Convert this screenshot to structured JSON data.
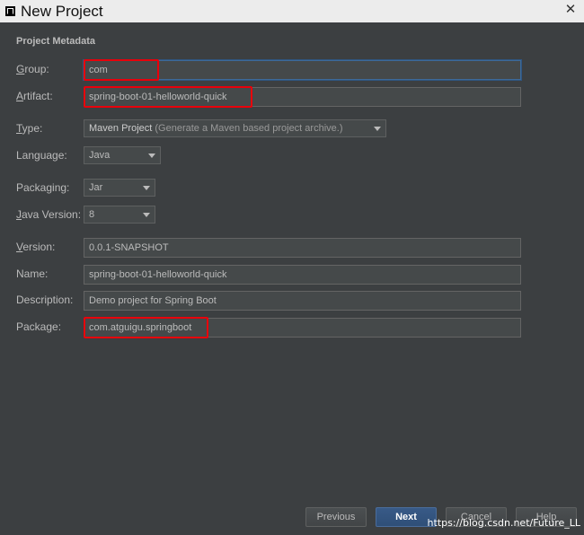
{
  "window": {
    "title": "New Project",
    "close_glyph": "✕"
  },
  "section_title": "Project Metadata",
  "fields": {
    "group": {
      "label_u": "G",
      "label_rest": "roup:",
      "value": "com"
    },
    "artifact": {
      "label_u": "A",
      "label_rest": "rtifact:",
      "value": "spring-boot-01-helloworld-quick"
    },
    "type": {
      "label_u": "T",
      "label_rest": "ype:",
      "value_main": "Maven Project",
      "value_sub": " (Generate a Maven based project archive.)"
    },
    "language": {
      "label": "Language:",
      "value": "Java"
    },
    "packaging": {
      "label": "Packaging:",
      "value": "Jar"
    },
    "java_version": {
      "label_u": "J",
      "label_rest": "ava Version:",
      "value": "8"
    },
    "version": {
      "label_u": "V",
      "label_rest": "ersion:",
      "value": "0.0.1-SNAPSHOT"
    },
    "name": {
      "label": "Name:",
      "value": "spring-boot-01-helloworld-quick"
    },
    "description": {
      "label": "Description:",
      "value": "Demo project for Spring Boot"
    },
    "package": {
      "label": "Package:",
      "value": "com.atguigu.springboot"
    }
  },
  "buttons": {
    "previous": "Previous",
    "next": "Next",
    "cancel": "Cancel",
    "help": "Help"
  },
  "watermark": "https://blog.csdn.net/Future_LL",
  "colors": {
    "background": "#3c3f41",
    "highlight_red": "#e8000b",
    "primary_button": "#385a87"
  }
}
